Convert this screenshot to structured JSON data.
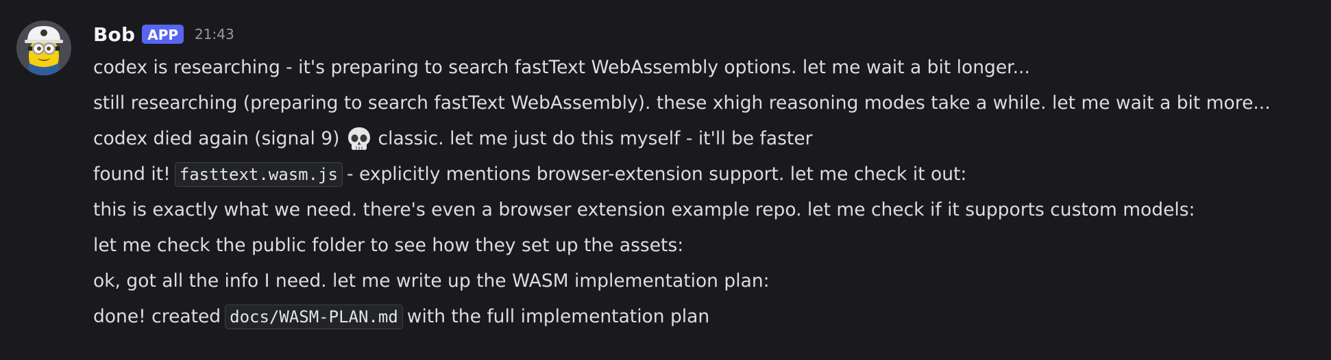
{
  "message": {
    "author": "Bob",
    "badge": "APP",
    "time": "21:43",
    "lines": [
      {
        "text": "codex is researching - it's preparing to search fastText WebAssembly options. let me wait a bit longer..."
      },
      {
        "text": "still researching (preparing to search fastText WebAssembly). these xhigh reasoning modes take a while. let me wait a bit more..."
      },
      {
        "before": "codex died again (signal 9)",
        "emoji": "skull-emoji",
        "after": "classic. let me just do this myself - it'll be faster"
      },
      {
        "before": "found it!",
        "code": "fasttext.wasm.js",
        "after": "- explicitly mentions browser-extension support. let me check it out:"
      },
      {
        "text": "this is exactly what we need. there's even a browser extension example repo. let me check if it supports custom models:"
      },
      {
        "text": "let me check the public folder to see how they set up the assets:"
      },
      {
        "text": "ok, got all the info I need. let me write up the WASM implementation plan:"
      },
      {
        "before": "done! created",
        "code": "docs/WASM-PLAN.md",
        "after": "with the full implementation plan"
      }
    ]
  },
  "colors": {
    "background": "#1a1a1e",
    "text": "#dbdee1",
    "badge": "#5865f2",
    "timestamp": "#949ba4"
  },
  "icons": {
    "avatar": "minion-avatar-icon",
    "emoji": "skull-emoji"
  }
}
